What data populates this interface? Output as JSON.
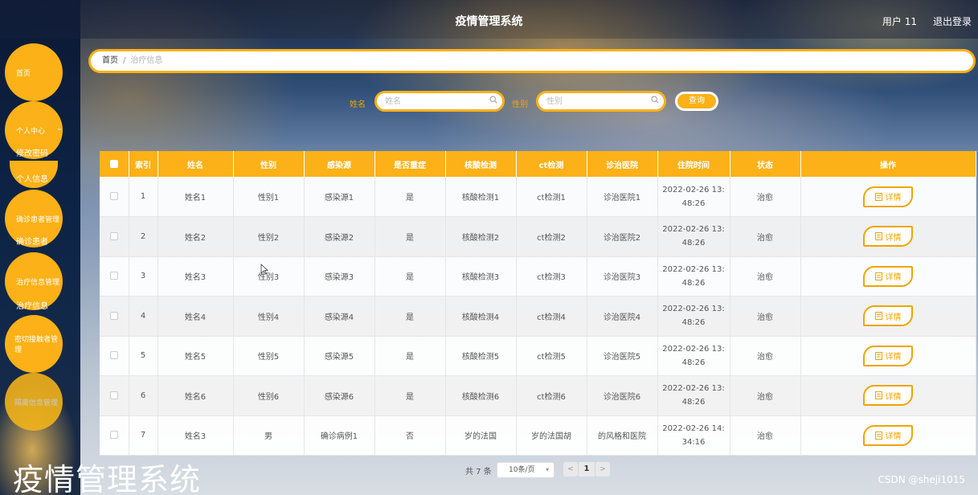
{
  "app": {
    "title": "疫情管理系统",
    "user": "用户 11",
    "logout": "退出登录"
  },
  "sidebar": {
    "items": [
      {
        "label": "首页"
      },
      {
        "label": "个人中心",
        "children": [
          "修改密码",
          "个人信息"
        ]
      },
      {
        "label": "确诊患者管理",
        "children": [
          "确诊患者"
        ]
      },
      {
        "label": "治疗信息管理",
        "children": [
          "治疗信息"
        ]
      },
      {
        "label": "密切接触者管理"
      },
      {
        "label": "隔离信息管理"
      }
    ]
  },
  "breadcrumb": {
    "home": "首页",
    "separator": "/",
    "current": "治疗信息"
  },
  "search": {
    "name_label": "姓名",
    "name_placeholder": "姓名",
    "gender_label": "性别",
    "gender_placeholder": "性别",
    "query_button": "查询"
  },
  "table": {
    "headers": [
      "索引",
      "姓名",
      "性别",
      "感染源",
      "是否重症",
      "核酸检测",
      "ct检测",
      "诊治医院",
      "住院时间",
      "状态",
      "操作"
    ],
    "detail_label": "详情",
    "rows": [
      {
        "index": "1",
        "name": "姓名1",
        "gender": "性别1",
        "source": "感染源1",
        "severe": "是",
        "nucleic": "核酸检测1",
        "ct": "ct检测1",
        "hospital": "诊治医院1",
        "time_a": "2022-02-26 13:",
        "time_b": "48:26",
        "status": "治愈"
      },
      {
        "index": "2",
        "name": "姓名2",
        "gender": "性别2",
        "source": "感染源2",
        "severe": "是",
        "nucleic": "核酸检测2",
        "ct": "ct检测2",
        "hospital": "诊治医院2",
        "time_a": "2022-02-26 13:",
        "time_b": "48:26",
        "status": "治愈"
      },
      {
        "index": "3",
        "name": "姓名3",
        "gender": "性别3",
        "source": "感染源3",
        "severe": "是",
        "nucleic": "核酸检测3",
        "ct": "ct检测3",
        "hospital": "诊治医院3",
        "time_a": "2022-02-26 13:",
        "time_b": "48:26",
        "status": "治愈"
      },
      {
        "index": "4",
        "name": "姓名4",
        "gender": "性别4",
        "source": "感染源4",
        "severe": "是",
        "nucleic": "核酸检测4",
        "ct": "ct检测4",
        "hospital": "诊治医院4",
        "time_a": "2022-02-26 13:",
        "time_b": "48:26",
        "status": "治愈"
      },
      {
        "index": "5",
        "name": "姓名5",
        "gender": "性别5",
        "source": "感染源5",
        "severe": "是",
        "nucleic": "核酸检测5",
        "ct": "ct检测5",
        "hospital": "诊治医院5",
        "time_a": "2022-02-26 13:",
        "time_b": "48:26",
        "status": "治愈"
      },
      {
        "index": "6",
        "name": "姓名6",
        "gender": "性别6",
        "source": "感染源6",
        "severe": "是",
        "nucleic": "核酸检测6",
        "ct": "ct检测6",
        "hospital": "诊治医院6",
        "time_a": "2022-02-26 13:",
        "time_b": "48:26",
        "status": "治愈"
      },
      {
        "index": "7",
        "name": "姓名3",
        "gender": "男",
        "source": "确诊病例1",
        "severe": "否",
        "nucleic": "岁的法国",
        "ct": "岁的法国胡",
        "hospital": "的风格和医院",
        "time_a": "2022-02-26 14:",
        "time_b": "34:16",
        "status": "治愈"
      }
    ]
  },
  "pagination": {
    "total": "共 7 条",
    "page_size": "10条/页",
    "current_page": "1",
    "prev": "<",
    "next": ">"
  },
  "overlay": {
    "title": "疫情管理系统",
    "watermark": "CSDN @sheji1015"
  },
  "colors": {
    "accent": "#fbb117",
    "accent_dark": "#f0a500"
  }
}
